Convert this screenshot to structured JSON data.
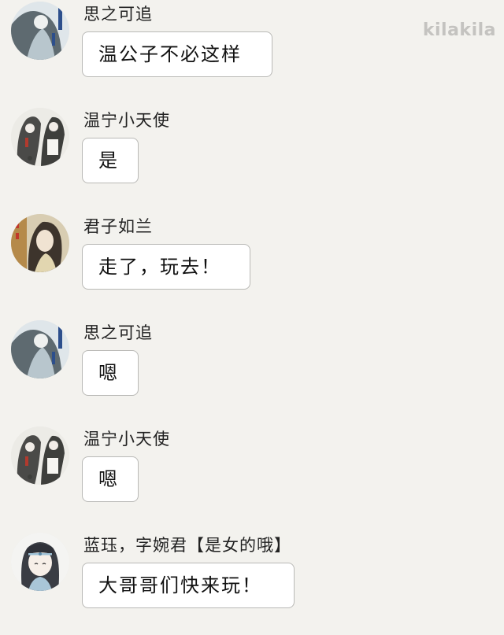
{
  "watermark": "kilakila",
  "messages": [
    {
      "name": "思之可追",
      "text": "温公子不必这样",
      "avatar_icon": "ink-portrait-blue-avatar"
    },
    {
      "name": "温宁小天使",
      "text": "是",
      "avatar_icon": "twins-portrait-avatar"
    },
    {
      "name": "君子如兰",
      "text": "走了，玩去！",
      "avatar_icon": "long-hair-portrait-avatar"
    },
    {
      "name": "思之可追",
      "text": "嗯",
      "avatar_icon": "ink-portrait-blue-avatar"
    },
    {
      "name": "温宁小天使",
      "text": "嗯",
      "avatar_icon": "twins-portrait-avatar"
    },
    {
      "name": "蓝珏，字婉君【是女的哦】",
      "text": "大哥哥们快来玩！",
      "avatar_icon": "chibi-girl-avatar"
    }
  ]
}
